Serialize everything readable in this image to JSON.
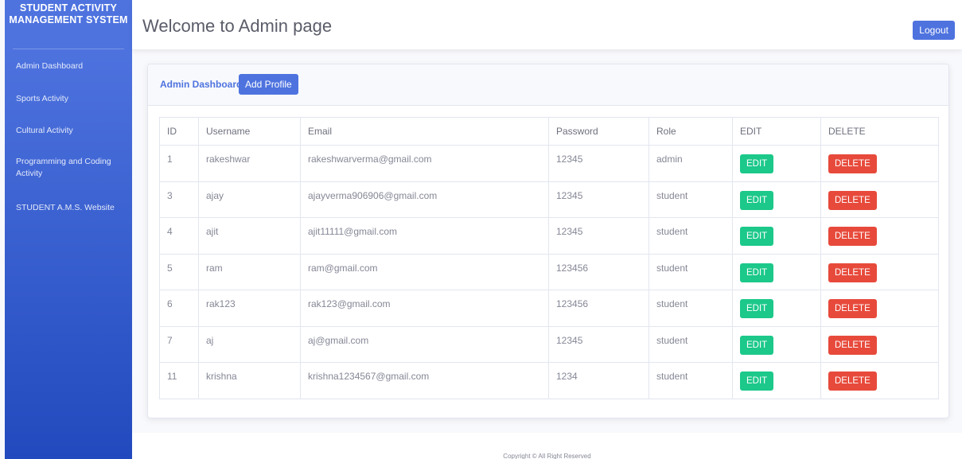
{
  "sidebar": {
    "brand": "STUDENT ACTIVITY MANAGEMENT SYSTEM",
    "items": [
      {
        "label": "Admin Dashboard"
      },
      {
        "label": "Sports Activity"
      },
      {
        "label": "Cultural Activity"
      },
      {
        "label": "Programming and Coding Activity"
      },
      {
        "label": "STUDENT A.M.S. Website"
      }
    ]
  },
  "header": {
    "title": "Welcome to Admin page",
    "logout_label": "Logout"
  },
  "card": {
    "breadcrumb": "Admin Dashboard",
    "add_profile_label": "Add Profile"
  },
  "table": {
    "columns": [
      "ID",
      "Username",
      "Email",
      "Password",
      "Role",
      "EDIT",
      "DELETE"
    ],
    "edit_label": "EDIT",
    "delete_label": "DELETE",
    "rows": [
      {
        "id": "1",
        "username": "rakeshwar",
        "email": "rakeshwarverma@gmail.com",
        "password": "12345",
        "role": "admin"
      },
      {
        "id": "3",
        "username": "ajay",
        "email": "ajayverma906906@gmail.com",
        "password": "12345",
        "role": "student"
      },
      {
        "id": "4",
        "username": "ajit",
        "email": "ajit11111@gmail.com",
        "password": "12345",
        "role": "student"
      },
      {
        "id": "5",
        "username": "ram",
        "email": "ram@gmail.com",
        "password": "123456",
        "role": "student"
      },
      {
        "id": "6",
        "username": "rak123",
        "email": "rak123@gmail.com",
        "password": "123456",
        "role": "student"
      },
      {
        "id": "7",
        "username": "aj",
        "email": "aj@gmail.com",
        "password": "12345",
        "role": "student"
      },
      {
        "id": "11",
        "username": "krishna",
        "email": "krishna1234567@gmail.com",
        "password": "1234",
        "role": "student"
      }
    ]
  },
  "footer": {
    "copyright": "Copyright © All Right Reserved"
  },
  "colors": {
    "primary": "#4e73df",
    "success": "#1cc88a",
    "danger": "#e74a3b"
  }
}
